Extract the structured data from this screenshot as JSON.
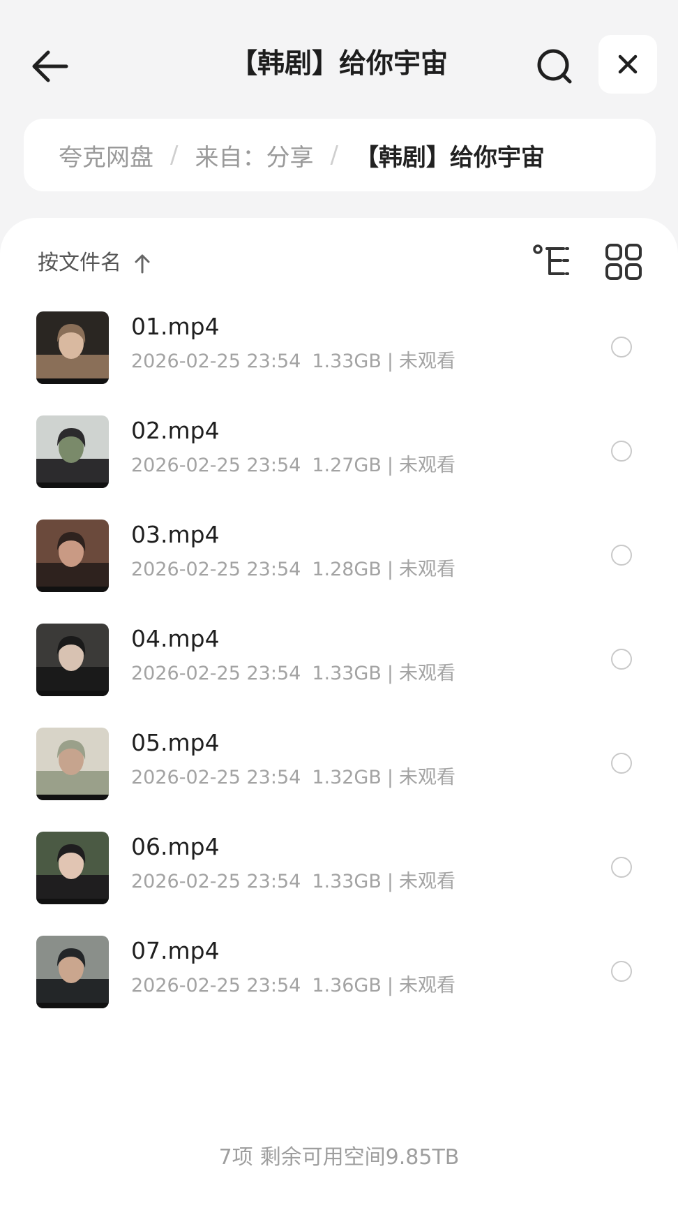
{
  "header": {
    "title": "【韩剧】给你宇宙",
    "back_icon": "arrow-left-icon",
    "search_icon": "search-icon",
    "close_icon": "close-icon"
  },
  "breadcrumb": {
    "items": [
      "夸克网盘",
      "来自：分享",
      "【韩剧】给你宇宙"
    ],
    "separator": "/"
  },
  "sort_bar": {
    "label": "按文件名",
    "direction_icon": "arrow-up-icon",
    "tree_icon": "folder-tree-icon",
    "grid_icon": "grid-view-icon"
  },
  "files": [
    {
      "name": "01.mp4",
      "date": "2026-02-25 23:54",
      "size": "1.33GB",
      "status": "未观看",
      "thumb_colors": [
        "#2a2622",
        "#8a6f58",
        "#d9b9a0"
      ]
    },
    {
      "name": "02.mp4",
      "date": "2026-02-25 23:54",
      "size": "1.27GB",
      "status": "未观看",
      "thumb_colors": [
        "#cfd3d0",
        "#2c2b2d",
        "#7a8a6a"
      ]
    },
    {
      "name": "03.mp4",
      "date": "2026-02-25 23:54",
      "size": "1.28GB",
      "status": "未观看",
      "thumb_colors": [
        "#6b4a3c",
        "#2e221e",
        "#c99a84"
      ]
    },
    {
      "name": "04.mp4",
      "date": "2026-02-25 23:54",
      "size": "1.33GB",
      "status": "未观看",
      "thumb_colors": [
        "#3b3a38",
        "#1a1a1a",
        "#d8c2b2"
      ]
    },
    {
      "name": "05.mp4",
      "date": "2026-02-25 23:54",
      "size": "1.32GB",
      "status": "未观看",
      "thumb_colors": [
        "#d8d4c8",
        "#9aa08a",
        "#c6a48e"
      ]
    },
    {
      "name": "06.mp4",
      "date": "2026-02-25 23:54",
      "size": "1.33GB",
      "status": "未观看",
      "thumb_colors": [
        "#4b5a44",
        "#1f1e1f",
        "#e1c5b3"
      ]
    },
    {
      "name": "07.mp4",
      "date": "2026-02-25 23:54",
      "size": "1.36GB",
      "status": "未观看",
      "thumb_colors": [
        "#8a8f8a",
        "#232628",
        "#caa68e"
      ]
    }
  ],
  "meta_separator": "|",
  "footer": {
    "count": "7项",
    "space": "剩余可用空间9.85TB"
  },
  "colors": {
    "background": "#f4f4f5",
    "panel": "#ffffff",
    "text_primary": "#1f1f1f",
    "text_secondary": "#a3a3a3"
  }
}
